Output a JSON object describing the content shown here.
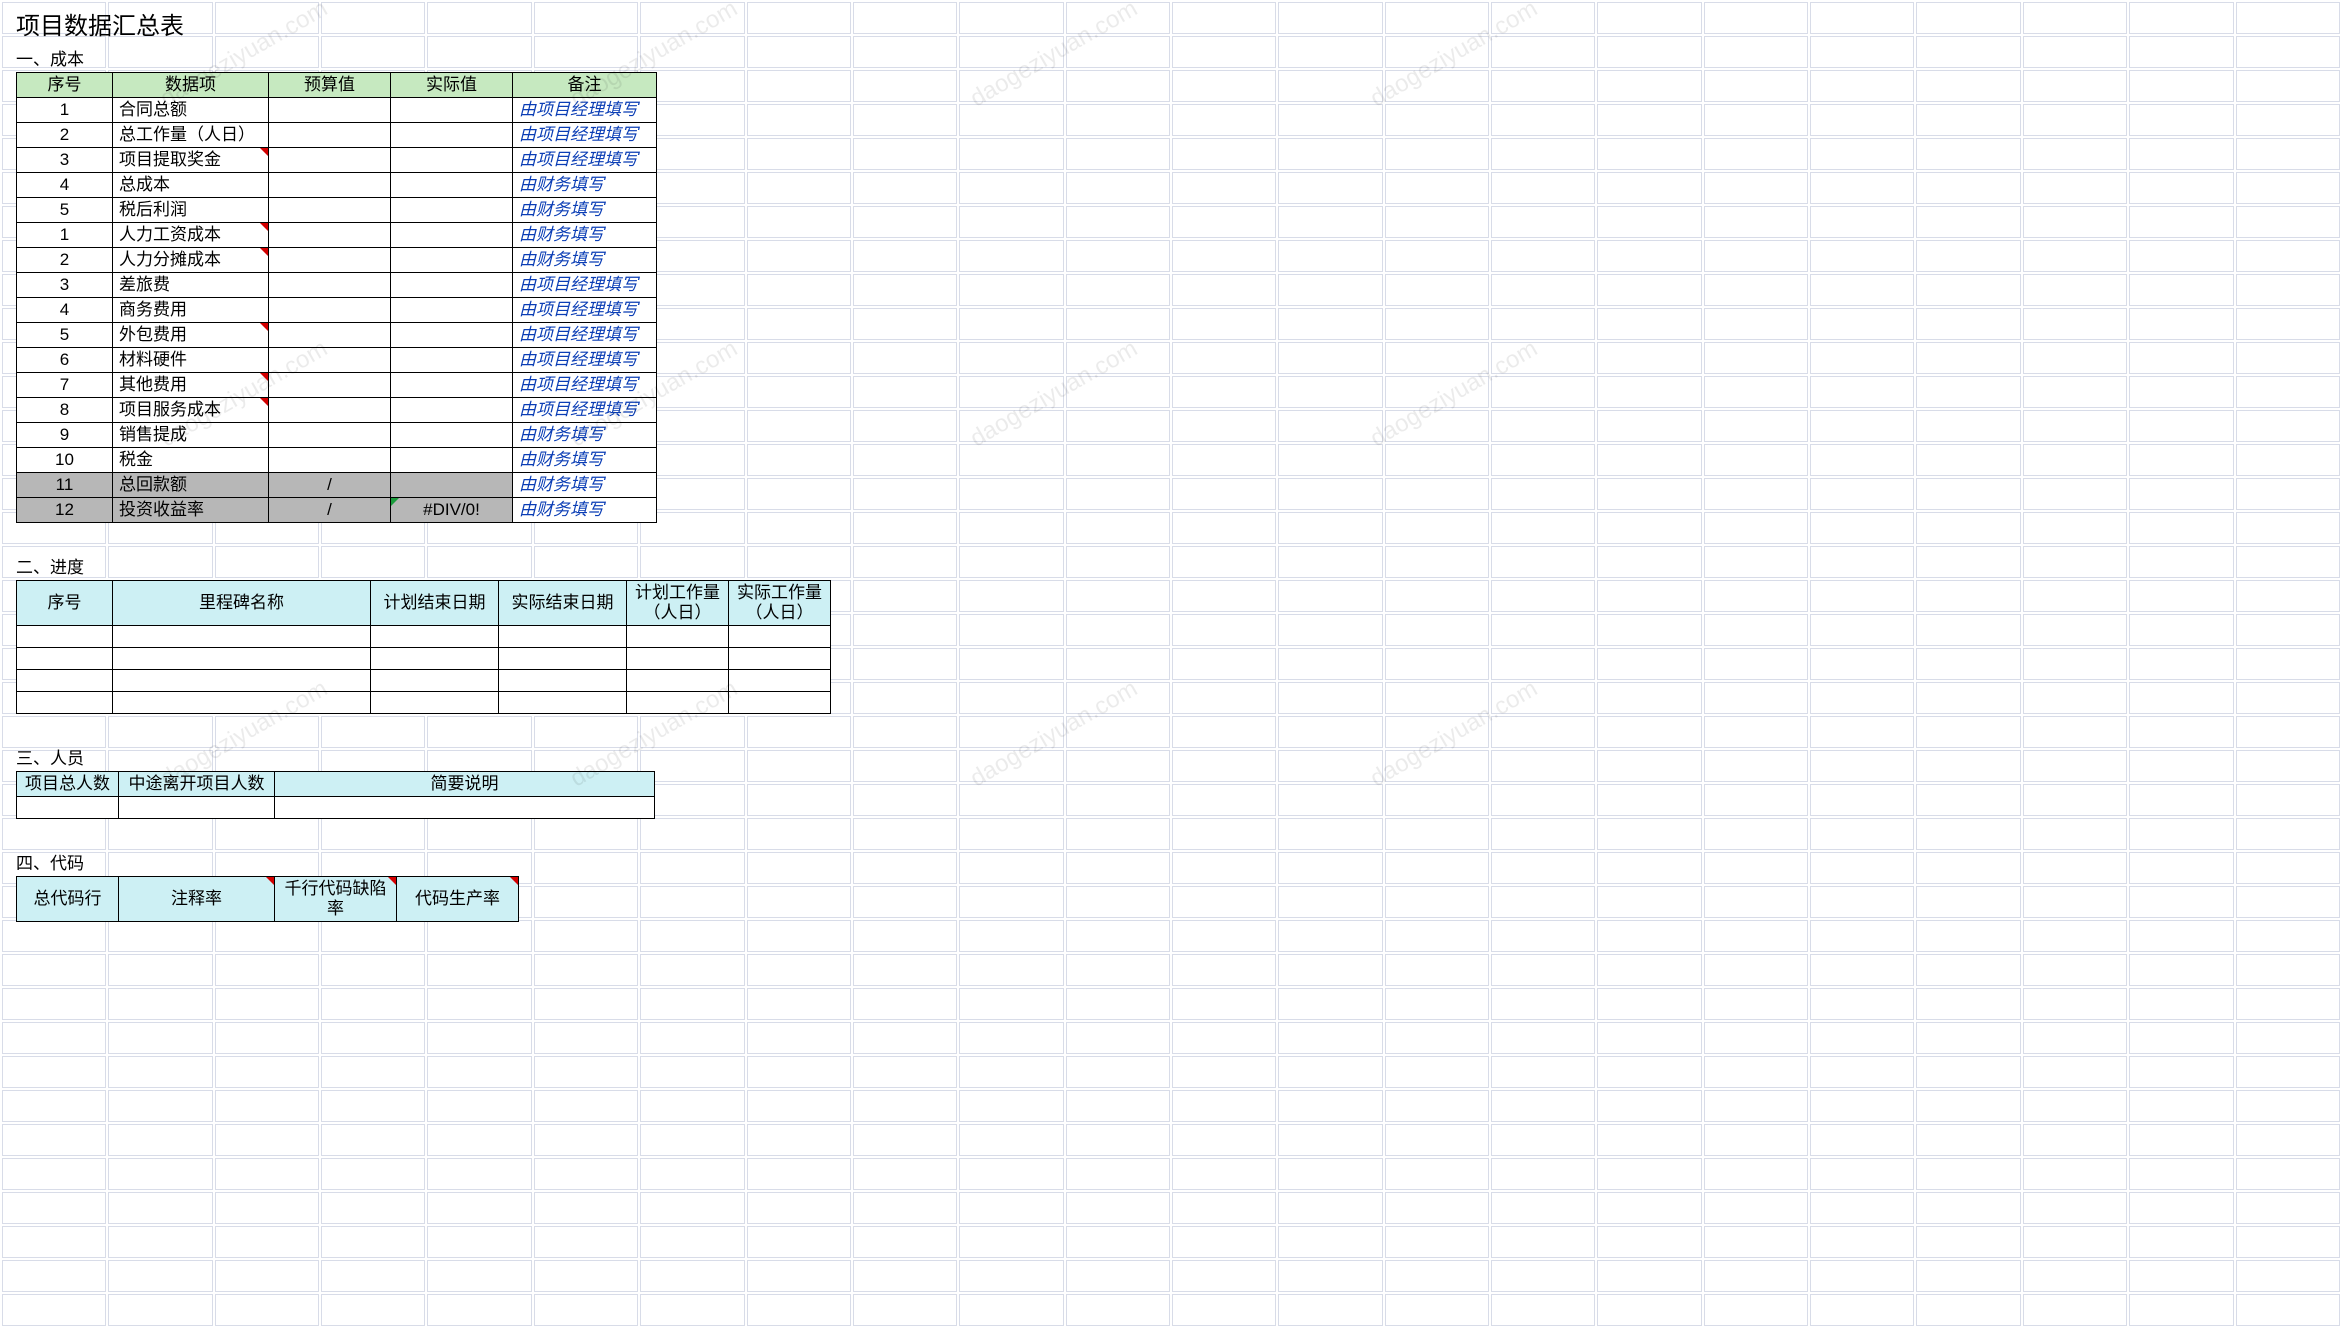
{
  "title": "项目数据汇总表",
  "watermark_text": "daogeziyuan.com",
  "section1": {
    "label": "一、成本",
    "headers": [
      "序号",
      "数据项",
      "预算值",
      "实际值",
      "备注"
    ],
    "rows": [
      {
        "seq": "1",
        "item": "合同总额",
        "budget": "",
        "actual": "",
        "remark": "由项目经理填写",
        "gray": false,
        "tri": false,
        "gtri": false
      },
      {
        "seq": "2",
        "item": "总工作量（人日）",
        "budget": "",
        "actual": "",
        "remark": "由项目经理填写",
        "gray": false,
        "tri": false,
        "gtri": false
      },
      {
        "seq": "3",
        "item": "项目提取奖金",
        "budget": "",
        "actual": "",
        "remark": "由项目经理填写",
        "gray": false,
        "tri": true,
        "gtri": false
      },
      {
        "seq": "4",
        "item": "总成本",
        "budget": "",
        "actual": "",
        "remark": "由财务填写",
        "gray": false,
        "tri": false,
        "gtri": false
      },
      {
        "seq": "5",
        "item": "税后利润",
        "budget": "",
        "actual": "",
        "remark": "由财务填写",
        "gray": false,
        "tri": false,
        "gtri": false
      },
      {
        "seq": "1",
        "item": "人力工资成本",
        "budget": "",
        "actual": "",
        "remark": "由财务填写",
        "gray": false,
        "tri": true,
        "gtri": false
      },
      {
        "seq": "2",
        "item": "人力分摊成本",
        "budget": "",
        "actual": "",
        "remark": "由财务填写",
        "gray": false,
        "tri": true,
        "gtri": false
      },
      {
        "seq": "3",
        "item": "差旅费",
        "budget": "",
        "actual": "",
        "remark": "由项目经理填写",
        "gray": false,
        "tri": false,
        "gtri": false
      },
      {
        "seq": "4",
        "item": "商务费用",
        "budget": "",
        "actual": "",
        "remark": "由项目经理填写",
        "gray": false,
        "tri": false,
        "gtri": false
      },
      {
        "seq": "5",
        "item": "外包费用",
        "budget": "",
        "actual": "",
        "remark": "由项目经理填写",
        "gray": false,
        "tri": true,
        "gtri": false
      },
      {
        "seq": "6",
        "item": "材料硬件",
        "budget": "",
        "actual": "",
        "remark": "由项目经理填写",
        "gray": false,
        "tri": false,
        "gtri": false
      },
      {
        "seq": "7",
        "item": "其他费用",
        "budget": "",
        "actual": "",
        "remark": "由项目经理填写",
        "gray": false,
        "tri": true,
        "gtri": false
      },
      {
        "seq": "8",
        "item": "项目服务成本",
        "budget": "",
        "actual": "",
        "remark": "由项目经理填写",
        "gray": false,
        "tri": true,
        "gtri": false
      },
      {
        "seq": "9",
        "item": "销售提成",
        "budget": "",
        "actual": "",
        "remark": "由财务填写",
        "gray": false,
        "tri": false,
        "gtri": false
      },
      {
        "seq": "10",
        "item": "税金",
        "budget": "",
        "actual": "",
        "remark": "由财务填写",
        "gray": false,
        "tri": false,
        "gtri": false
      },
      {
        "seq": "11",
        "item": "总回款额",
        "budget": "/",
        "actual": "",
        "remark": "由财务填写",
        "gray": true,
        "tri": false,
        "gtri": false
      },
      {
        "seq": "12",
        "item": "投资收益率",
        "budget": "/",
        "actual": "#DIV/0!",
        "remark": "由财务填写",
        "gray": true,
        "tri": false,
        "gtri": true
      }
    ]
  },
  "section2": {
    "label": "二、进度",
    "headers": [
      "序号",
      "里程碑名称",
      "计划结束日期",
      "实际结束日期",
      "计划工作量（人日）",
      "实际工作量（人日）"
    ]
  },
  "section3": {
    "label": "三、人员",
    "headers": [
      "项目总人数",
      "中途离开项目人数",
      "简要说明"
    ]
  },
  "section4": {
    "label": "四、代码",
    "headers": [
      "总代码行",
      "注释率",
      "千行代码缺陷率",
      "代码生产率"
    ]
  }
}
